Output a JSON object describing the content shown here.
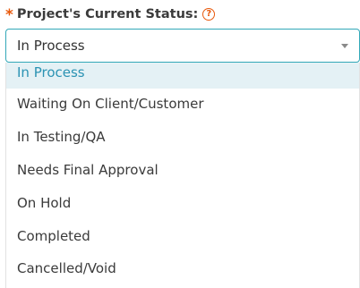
{
  "field": {
    "required_mark": "*",
    "label": "Project's Current Status:",
    "help_icon": "?",
    "selected_value": "In Process"
  },
  "dropdown": {
    "options": [
      {
        "label": "In Process",
        "selected": true
      },
      {
        "label": "Waiting On Client/Customer",
        "selected": false
      },
      {
        "label": "In Testing/QA",
        "selected": false
      },
      {
        "label": "Needs Final Approval",
        "selected": false
      },
      {
        "label": "On Hold",
        "selected": false
      },
      {
        "label": "Completed",
        "selected": false
      },
      {
        "label": "Cancelled/Void",
        "selected": false
      }
    ]
  },
  "colors": {
    "accent": "#32a8b8",
    "required": "#e8590c",
    "selected_bg": "#e4f1f5",
    "selected_text": "#2b93b3"
  },
  "icons": {
    "help": "question-circle-icon",
    "caret": "caret-down-icon"
  }
}
